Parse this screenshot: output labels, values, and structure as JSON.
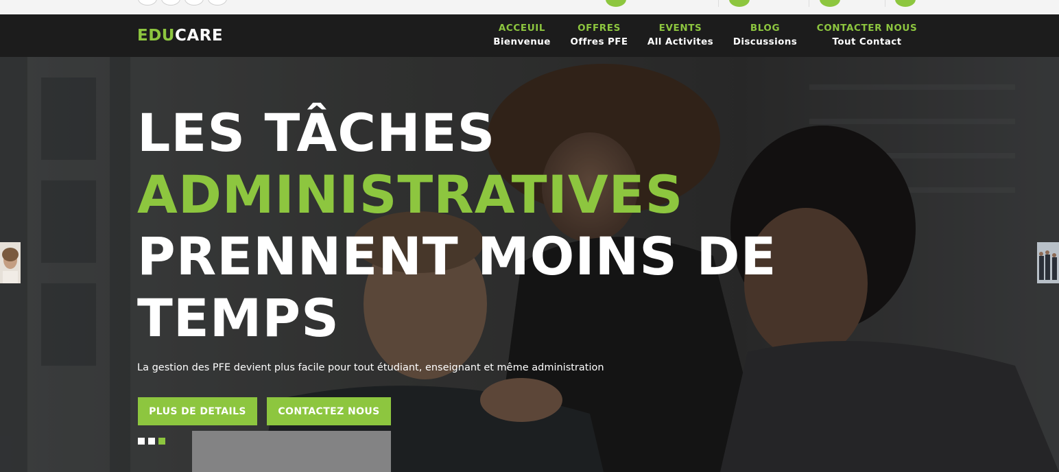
{
  "brand": {
    "part1": "EDU",
    "part2": "CARE"
  },
  "nav": [
    {
      "title": "ACCEUIL",
      "subtitle": "Bienvenue"
    },
    {
      "title": "OFFRES",
      "subtitle": "Offres PFE"
    },
    {
      "title": "EVENTS",
      "subtitle": "All Activites"
    },
    {
      "title": "BLOG",
      "subtitle": "Discussions"
    },
    {
      "title": "CONTACTER NOUS",
      "subtitle": "Tout Contact"
    }
  ],
  "hero": {
    "title_line1": "LES TÂCHES",
    "title_line2": "ADMINISTRATIVES",
    "title_line3": "PRENNENT MOINS DE",
    "title_line4": "TEMPS",
    "subtitle": "La gestion des PFE devient plus facile pour tout étudiant, enseignant et même administration",
    "primary_button": "PLUS DE DETAILS",
    "secondary_button": "CONTACTEZ NOUS",
    "slides_total": 3,
    "active_slide": 3
  },
  "colors": {
    "accent": "#8dc63f",
    "navbar": "#1c1c1c",
    "topbar": "#f4f4f4"
  },
  "icons": [
    "social-icon",
    "email-icon",
    "phone-icon",
    "clock-icon",
    "search-icon"
  ]
}
